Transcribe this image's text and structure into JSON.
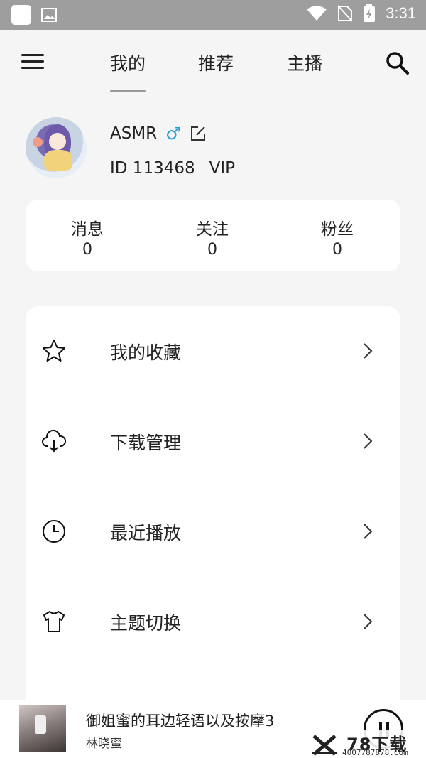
{
  "status_bar": {
    "time": "3:31"
  },
  "nav": {
    "tabs": [
      {
        "label": "我的",
        "active": true
      },
      {
        "label": "推荐",
        "active": false
      },
      {
        "label": "主播",
        "active": false
      }
    ]
  },
  "profile": {
    "name": "ASMR",
    "gender_symbol": "♂",
    "id_label": "ID 113468",
    "vip_label": "VIP"
  },
  "stats": [
    {
      "label": "消息",
      "value": "0"
    },
    {
      "label": "关注",
      "value": "0"
    },
    {
      "label": "粉丝",
      "value": "0"
    }
  ],
  "menu": [
    {
      "label": "我的收藏",
      "icon": "star-icon"
    },
    {
      "label": "下载管理",
      "icon": "cloud-download-icon"
    },
    {
      "label": "最近播放",
      "icon": "clock-icon"
    },
    {
      "label": "主题切换",
      "icon": "tshirt-icon"
    }
  ],
  "player": {
    "title": "御姐蜜的耳边轻语以及按摩3",
    "artist": "林晓蜜"
  },
  "watermark": {
    "text": "78下载",
    "url": "4007787878.Com"
  },
  "colors": {
    "accent_male": "#2a9fd8",
    "background": "#f5f5f5",
    "card": "#ffffff"
  }
}
